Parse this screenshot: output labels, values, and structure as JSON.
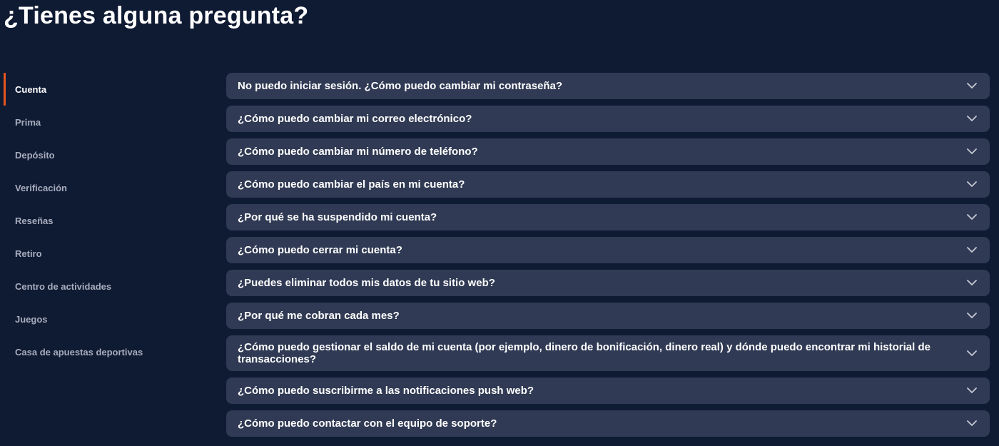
{
  "header": {
    "title": "¿Tienes alguna pregunta?"
  },
  "sidebar": {
    "active_index": 0,
    "accent_color": "#e8571e",
    "items": [
      {
        "label": "Cuenta"
      },
      {
        "label": "Prima"
      },
      {
        "label": "Depósito"
      },
      {
        "label": "Verificación"
      },
      {
        "label": "Reseñas"
      },
      {
        "label": "Retiro"
      },
      {
        "label": "Centro de actividades"
      },
      {
        "label": "Juegos"
      },
      {
        "label": "Casa de apuestas deportivas"
      }
    ]
  },
  "faq": {
    "expand_icon": "chevron-down-icon",
    "items": [
      {
        "question": "No puedo iniciar sesión. ¿Cómo puedo cambiar mi contraseña?"
      },
      {
        "question": "¿Cómo puedo cambiar mi correo electrónico?"
      },
      {
        "question": "¿Cómo puedo cambiar mi número de teléfono?"
      },
      {
        "question": "¿Cómo puedo cambiar el país en mi cuenta?"
      },
      {
        "question": "¿Por qué se ha suspendido mi cuenta?"
      },
      {
        "question": "¿Cómo puedo cerrar mi cuenta?"
      },
      {
        "question": "¿Puedes eliminar todos mis datos de tu sitio web?"
      },
      {
        "question": "¿Por qué me cobran cada mes?"
      },
      {
        "question": "¿Cómo puedo gestionar el saldo de mi cuenta (por ejemplo, dinero de bonificación, dinero real) y dónde puedo encontrar mi historial de transacciones?"
      },
      {
        "question": "¿Cómo puedo suscribirme a las notificaciones push web?"
      },
      {
        "question": "¿Cómo puedo contactar con el equipo de soporte?"
      }
    ]
  },
  "colors": {
    "background": "#0f1a33",
    "card": "#303a54",
    "text": "#ffffff",
    "muted_text": "#a7adbd"
  }
}
